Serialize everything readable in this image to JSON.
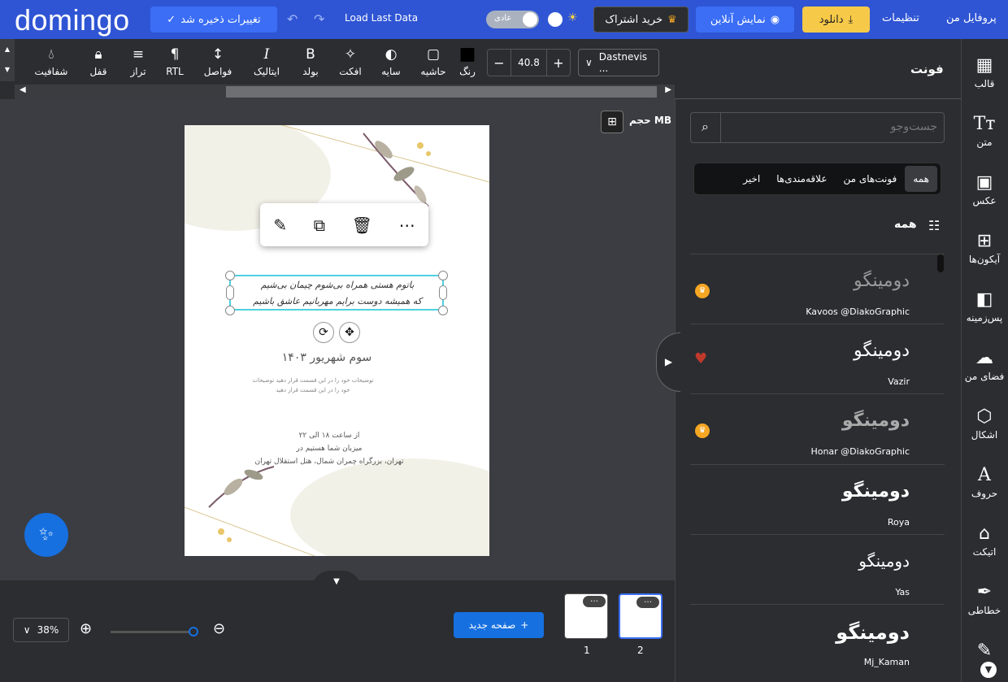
{
  "app": {
    "logo": "domingo",
    "save_status": "تغییرات ذخیره شد",
    "load_last": "Load Last Data",
    "mode_label": "عادی",
    "subscribe": "خرید اشتراک",
    "preview": "نمایش آنلاین",
    "download": "دانلود",
    "settings": "تنظیمات",
    "profile": "پروفایل من"
  },
  "toolbar": {
    "font_family": "Dastnevis ...",
    "font_size": "40.8",
    "tools": [
      {
        "label": "رنگ",
        "icon": "■"
      },
      {
        "label": "حاشیه",
        "icon": "▢"
      },
      {
        "label": "سایه",
        "icon": "◐"
      },
      {
        "label": "افکت",
        "icon": "✧"
      },
      {
        "label": "بولد",
        "icon": "B"
      },
      {
        "label": "ایتالیک",
        "icon": "I"
      },
      {
        "label": "فواصل",
        "icon": "↕"
      },
      {
        "label": "RTL",
        "icon": "¶"
      },
      {
        "label": "تراز",
        "icon": "≡"
      },
      {
        "label": "قفل",
        "icon": "🔒"
      },
      {
        "label": "شفافیت",
        "icon": "💧"
      }
    ]
  },
  "canvas": {
    "size_label": "حجم MB",
    "selected_line1": "باتوم هستی همراه بی‌شوم چیمان بی‌شیم",
    "selected_line2": "که همیشه دوست برایم مهربانیم عاشق باشیم",
    "date": "سوم شهریور ۱۴۰۳",
    "description": "توضیحات خود را در این قسمت قرار دهید توضیحات خود را در این قسمت قرار دهید",
    "time": "از ساعت ۱۸ الی ۲۲",
    "host": "میزبان شما هستیم در",
    "address": "تهران، بزرگراه چمران شمال، هتل استقلال تهران"
  },
  "bottom": {
    "zoom": "38%",
    "new_page": "صفحه جدید",
    "pages": [
      "1",
      "2"
    ]
  },
  "panel": {
    "title": "فونت",
    "search_placeholder": "جست‌وجو",
    "tabs": [
      "همه",
      "فونت‌های من",
      "علاقه‌مندی‌ها",
      "اخیر"
    ],
    "section": "همه",
    "fonts": [
      {
        "sample": "دومینگو",
        "name": "Kavoos @DiakoGraphic",
        "badge": "premium"
      },
      {
        "sample": "دومینگو",
        "name": "Vazir",
        "badge": "favorite"
      },
      {
        "sample": "دومینگو",
        "name": "Honar @DiakoGraphic",
        "badge": "premium"
      },
      {
        "sample": "دومینگو",
        "name": "Roya",
        "badge": ""
      },
      {
        "sample": "دومینگو",
        "name": "Yas",
        "badge": ""
      },
      {
        "sample": "دومینگو",
        "name": "Mj_Kaman",
        "badge": ""
      }
    ]
  },
  "rail": [
    {
      "label": "قالب",
      "icon": "▦"
    },
    {
      "label": "متن",
      "icon": "Tт"
    },
    {
      "label": "عکس",
      "icon": "🖼"
    },
    {
      "label": "آیکون‌ها",
      "icon": "⊞"
    },
    {
      "label": "پس‌زمینه",
      "icon": "◧"
    },
    {
      "label": "فضای من",
      "icon": "☁"
    },
    {
      "label": "اشکال",
      "icon": "⬡"
    },
    {
      "label": "حروف",
      "icon": "A"
    },
    {
      "label": "اتیکت",
      "icon": "🏷"
    },
    {
      "label": "خطاطی",
      "icon": "✒"
    }
  ]
}
